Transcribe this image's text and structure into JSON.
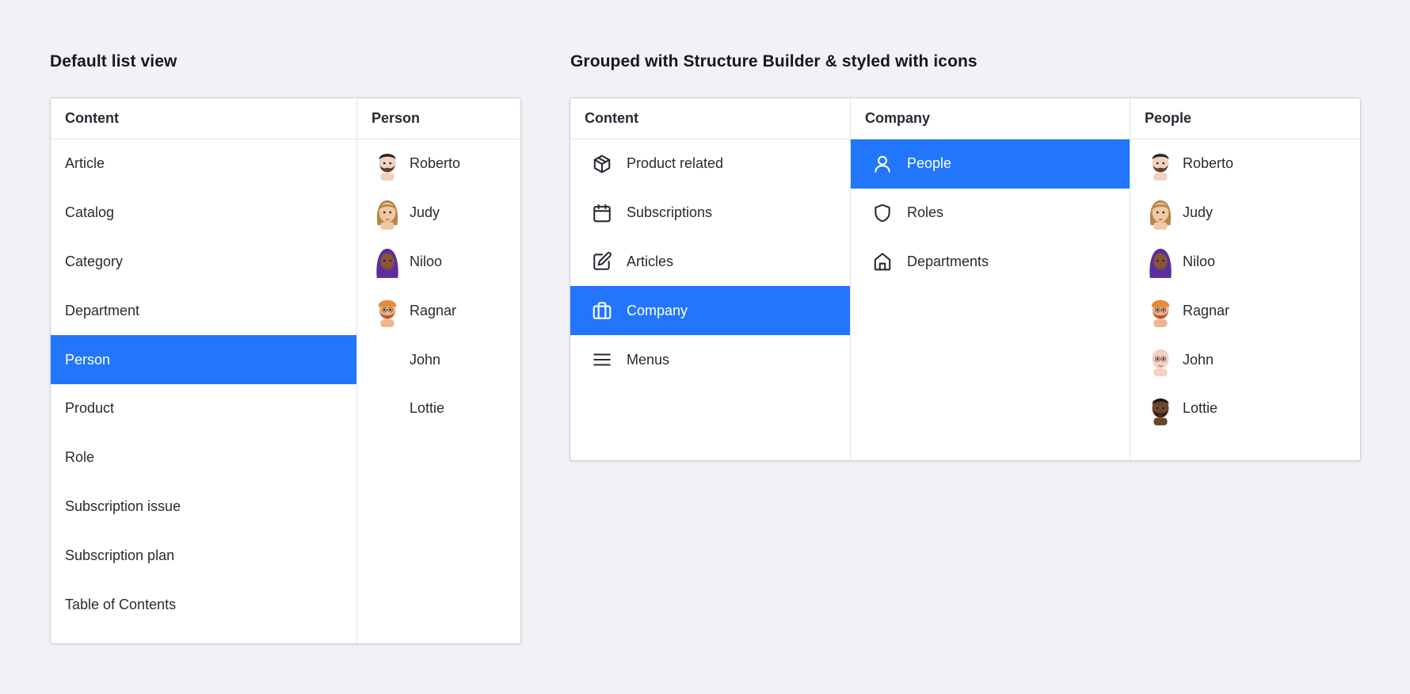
{
  "left": {
    "title": "Default list view",
    "content_pane": {
      "header": "Content",
      "items": [
        {
          "label": "Article",
          "selected": false
        },
        {
          "label": "Catalog",
          "selected": false
        },
        {
          "label": "Category",
          "selected": false
        },
        {
          "label": "Department",
          "selected": false
        },
        {
          "label": "Person",
          "selected": true
        },
        {
          "label": "Product",
          "selected": false
        },
        {
          "label": "Role",
          "selected": false
        },
        {
          "label": "Subscription issue",
          "selected": false
        },
        {
          "label": "Subscription plan",
          "selected": false
        },
        {
          "label": "Table of Contents",
          "selected": false
        }
      ]
    },
    "person_pane": {
      "header": "Person",
      "items": [
        {
          "label": "Roberto",
          "avatar": "roberto-avatar"
        },
        {
          "label": "Judy",
          "avatar": "judy-avatar"
        },
        {
          "label": "Niloo",
          "avatar": "niloo-avatar"
        },
        {
          "label": "Ragnar",
          "avatar": "ragnar-avatar"
        },
        {
          "label": "John",
          "avatar": null
        },
        {
          "label": "Lottie",
          "avatar": null
        }
      ]
    }
  },
  "right": {
    "title": "Grouped with Structure Builder & styled with icons",
    "content_pane": {
      "header": "Content",
      "items": [
        {
          "label": "Product related",
          "icon": "package-icon",
          "selected": false
        },
        {
          "label": "Subscriptions",
          "icon": "calendar-icon",
          "selected": false
        },
        {
          "label": "Articles",
          "icon": "edit-icon",
          "selected": false
        },
        {
          "label": "Company",
          "icon": "briefcase-icon",
          "selected": true
        },
        {
          "label": "Menus",
          "icon": "menu-icon",
          "selected": false
        }
      ]
    },
    "company_pane": {
      "header": "Company",
      "items": [
        {
          "label": "People",
          "icon": "user-icon",
          "selected": true
        },
        {
          "label": "Roles",
          "icon": "shield-icon",
          "selected": false
        },
        {
          "label": "Departments",
          "icon": "home-icon",
          "selected": false
        }
      ]
    },
    "people_pane": {
      "header": "People",
      "items": [
        {
          "label": "Roberto",
          "avatar": "roberto-avatar"
        },
        {
          "label": "Judy",
          "avatar": "judy-avatar"
        },
        {
          "label": "Niloo",
          "avatar": "niloo-avatar"
        },
        {
          "label": "Ragnar",
          "avatar": "ragnar-avatar"
        },
        {
          "label": "John",
          "avatar": "john-avatar"
        },
        {
          "label": "Lottie",
          "avatar": "lottie-avatar"
        }
      ]
    }
  },
  "colors": {
    "selected": "#2276fc",
    "background": "#f1f2f6"
  }
}
